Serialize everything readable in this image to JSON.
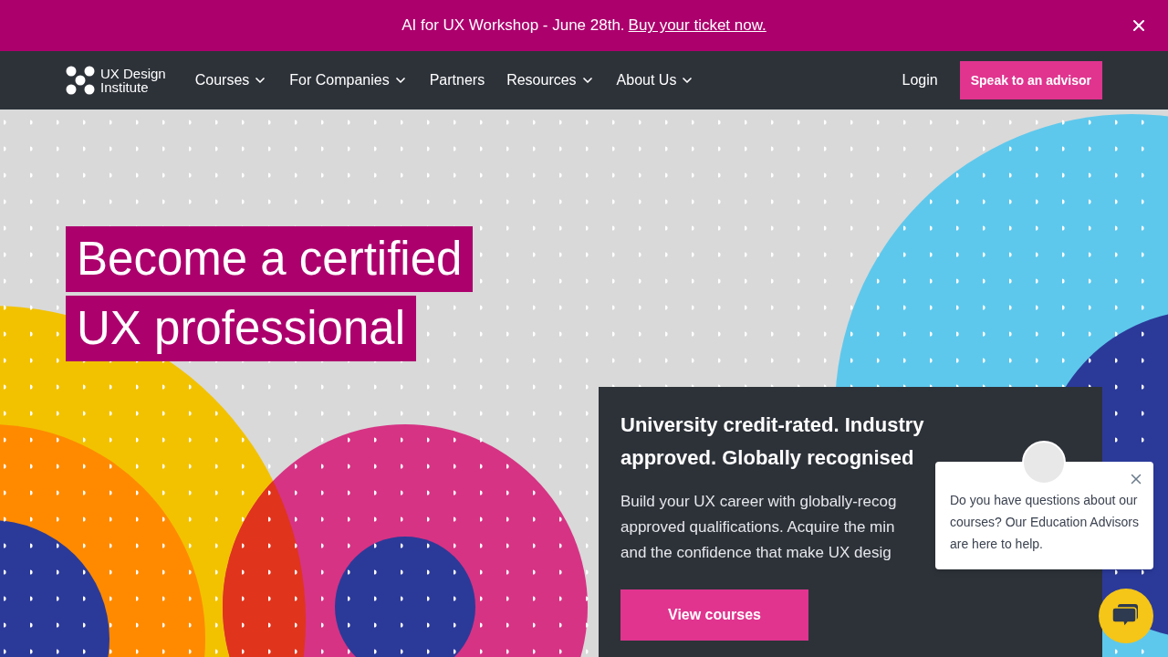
{
  "announcement": {
    "text": "AI for UX Workshop - June 28th.",
    "link": "Buy your ticket now."
  },
  "logo": {
    "line1": "UX Design",
    "line2": "Institute"
  },
  "nav": [
    {
      "label": "Courses",
      "dropdown": true
    },
    {
      "label": "For Companies",
      "dropdown": true
    },
    {
      "label": "Partners",
      "dropdown": false
    },
    {
      "label": "Resources",
      "dropdown": true
    },
    {
      "label": "About Us",
      "dropdown": true
    }
  ],
  "login": "Login",
  "cta": "Speak to an advisor",
  "hero": {
    "title_lines": [
      "Become a certified",
      "UX professional"
    ]
  },
  "card": {
    "heading": "University credit-rated. Industry approved. Globally recognised",
    "body_lines": [
      "Build your UX career with globally-recog",
      "approved qualifications. Acquire the min",
      "and the confidence that make UX desig"
    ],
    "button": "View courses"
  },
  "chat": {
    "message": "Do you have questions about our courses? Our Education Advisors are here to help."
  }
}
